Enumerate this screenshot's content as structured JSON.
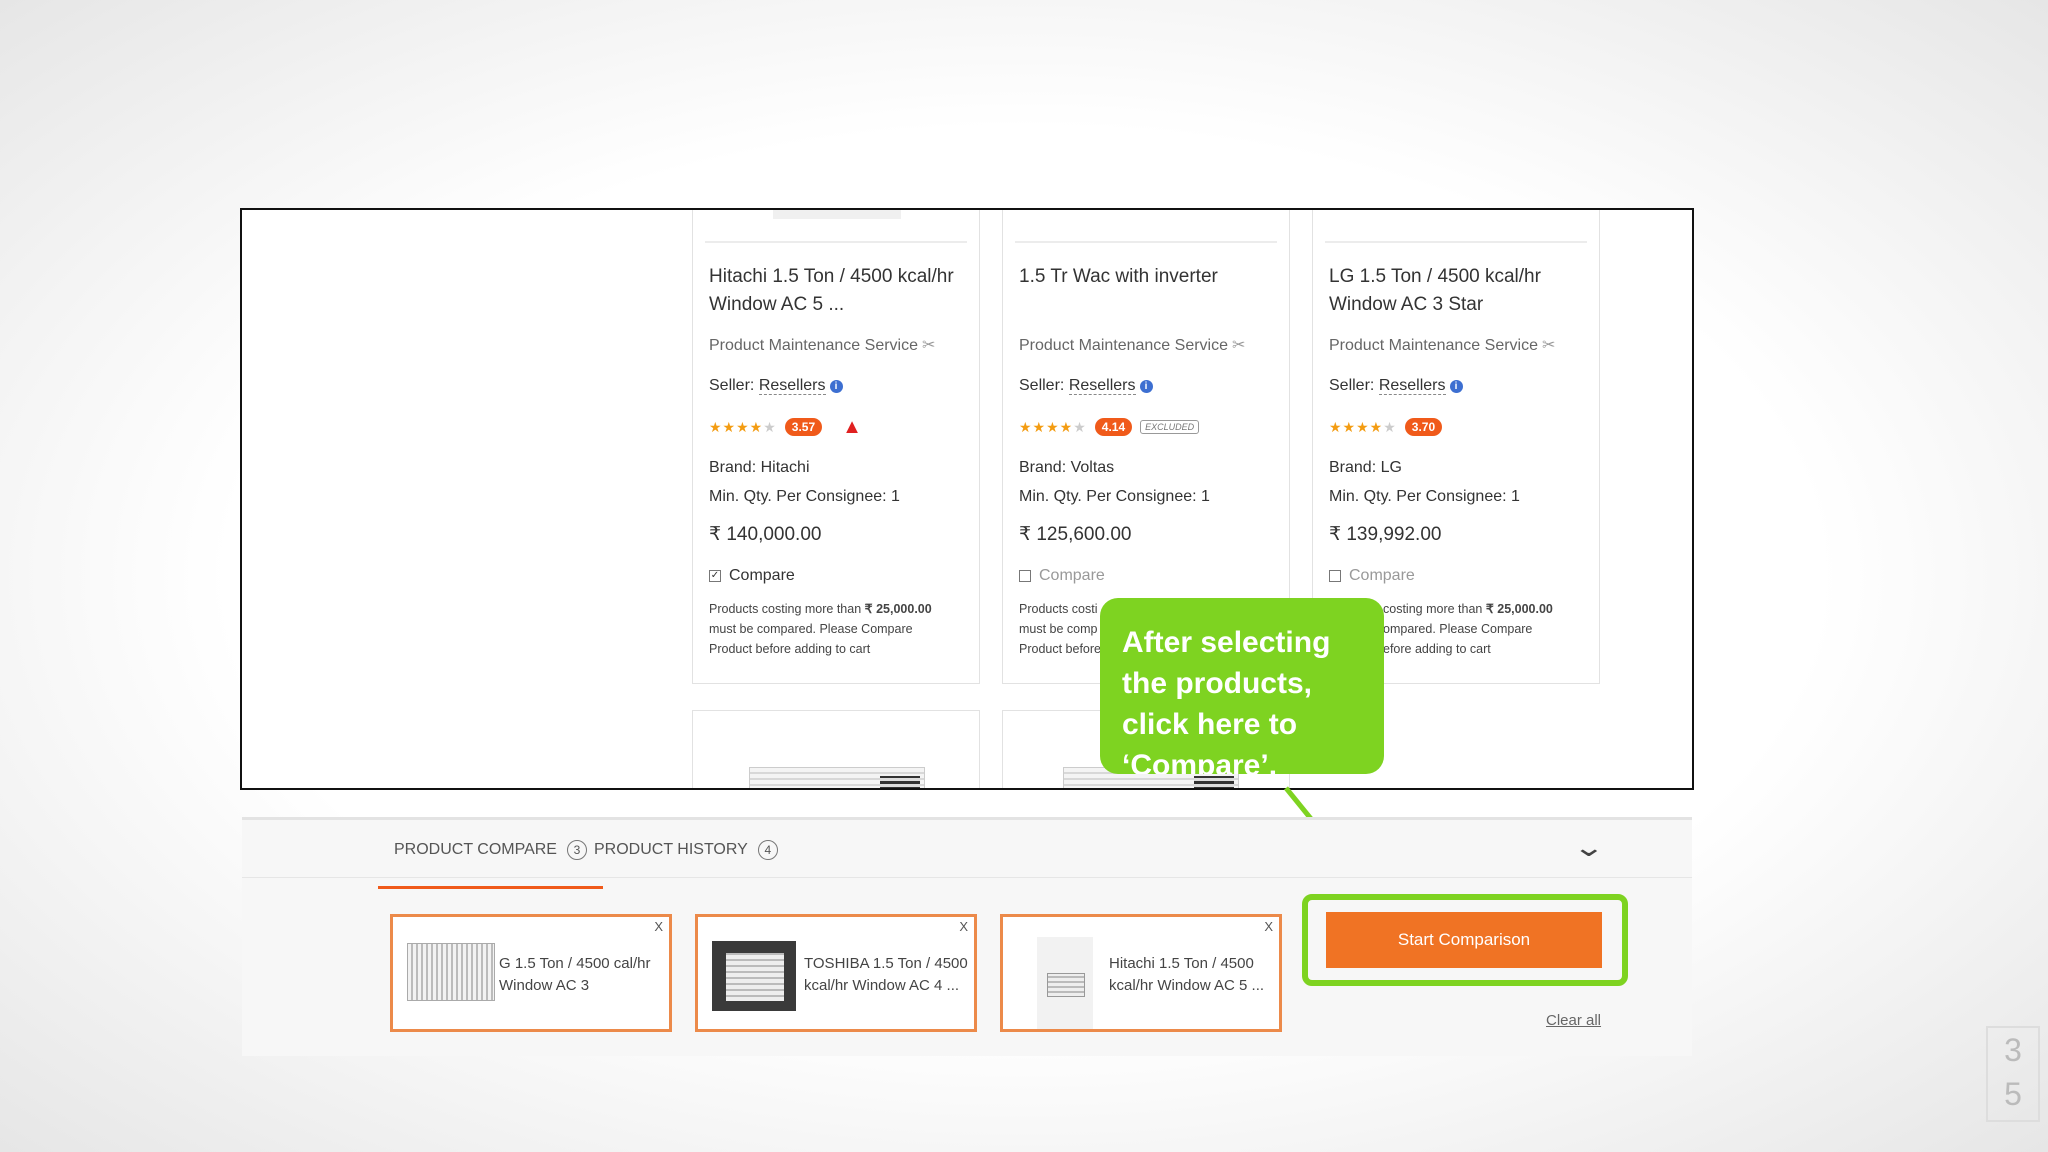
{
  "products": [
    {
      "title": "Hitachi 1.5 Ton / 4500 kcal/hr Window AC 5 ...",
      "service": "Product Maintenance Service",
      "seller_label": "Seller:",
      "seller": "Resellers",
      "rating": "3.57",
      "brand": "Brand: Hitachi",
      "min_qty": "Min. Qty. Per Consignee: 1",
      "price": "₹ 140,000.00",
      "compare_label": "Compare",
      "compare_checked": true,
      "note_pre": "Products costing more than",
      "note_amount": "₹ 25,000.00",
      "note_post": "must be compared. Please Compare Product before adding to cart"
    },
    {
      "title": "1.5 Tr Wac with inverter",
      "service": "Product Maintenance Service",
      "seller_label": "Seller:",
      "seller": "Resellers",
      "rating": "4.14",
      "excluded_badge": "EXCLUDED",
      "brand": "Brand: Voltas",
      "min_qty": "Min. Qty. Per Consignee: 1",
      "price": "₹ 125,600.00",
      "compare_label": "Compare",
      "compare_checked": false,
      "note_visible_1": "Products costi",
      "note_visible_2": "must be comp",
      "note_visible_3": "Product before"
    },
    {
      "title": "LG 1.5 Ton / 4500 kcal/hr Window AC 3 Star",
      "service": "Product Maintenance Service",
      "seller_label": "Seller:",
      "seller": "Resellers",
      "rating": "3.70",
      "brand": "Brand: LG",
      "min_qty": "Min. Qty. Per Consignee: 1",
      "price": "₹ 139,992.00",
      "compare_label": "Compare",
      "compare_checked": false,
      "note_visible_1": "costing more than",
      "note_amount": "₹ 25,000.00",
      "note_visible_2": "ompared. Please Compare",
      "note_visible_3": "efore adding to cart"
    }
  ],
  "callout": {
    "text": "After selecting the products, click here to ‘Compare’."
  },
  "compare_panel": {
    "tabs": [
      {
        "label": "PRODUCT COMPARE",
        "count": "3",
        "active": true
      },
      {
        "label": "PRODUCT HISTORY",
        "count": "4",
        "active": false
      }
    ],
    "items": [
      {
        "name": "G 1.5 Ton / 4500 cal/hr Window AC 3",
        "close": "X"
      },
      {
        "name": "TOSHIBA 1.5 Ton / 4500 kcal/hr Window AC 4 ...",
        "close": "X"
      },
      {
        "name": "Hitachi 1.5 Ton / 4500 kcal/hr Window AC 5 ...",
        "close": "X"
      }
    ],
    "start_button": "Start Comparison",
    "clear_all": "Clear all"
  },
  "slide_number": {
    "line1": "3",
    "line2": "5"
  },
  "colors": {
    "accent": "#f05a1a",
    "highlight": "#7ed321",
    "button": "#f07324"
  }
}
